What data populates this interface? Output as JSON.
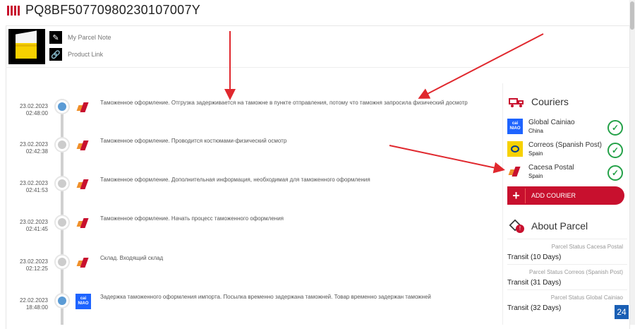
{
  "header": {
    "tracking_number": "PQ8BF50770980230107007Y"
  },
  "product": {
    "note_label": "My Parcel Note",
    "link_label": "Product Link"
  },
  "events": [
    {
      "date": "23.02.2023",
      "time": "02:48:00",
      "courier": "cacesa",
      "node": "blue",
      "text": "Таможенное оформление. Отгрузка задерживается на таможне в пункте отправления, потому что таможня запросила физический досмотр"
    },
    {
      "date": "23.02.2023",
      "time": "02:42:38",
      "courier": "cacesa",
      "node": "gray",
      "text": "Таможенное оформление. Проводится костюмами-физический осмотр"
    },
    {
      "date": "23.02.2023",
      "time": "02:41:53",
      "courier": "cacesa",
      "node": "gray",
      "text": "Таможенное оформление. Дополнительная информация, необходимая для таможенного оформления"
    },
    {
      "date": "23.02.2023",
      "time": "02:41:45",
      "courier": "cacesa",
      "node": "gray",
      "text": "Таможенное оформление. Начать процесс таможенного оформления"
    },
    {
      "date": "23.02.2023",
      "time": "02:12:25",
      "courier": "cacesa",
      "node": "gray",
      "text": "Склад. Входящий склад"
    },
    {
      "date": "22.02.2023",
      "time": "18:48:00",
      "courier": "cainiao",
      "node": "blue",
      "text": "Задержка таможенного оформления импорта. Посылка временно задержана таможней. Товар временно задержан таможней"
    }
  ],
  "couriers": {
    "title": "Couriers",
    "items": [
      {
        "name": "Global Cainiao",
        "country": "China",
        "logo": "cainiao"
      },
      {
        "name": "Correos (Spanish Post)",
        "country": "Spain",
        "logo": "correos"
      },
      {
        "name": "Cacesa Postal",
        "country": "Spain",
        "logo": "cacesa"
      }
    ],
    "add_label": "ADD COURIER"
  },
  "about": {
    "title": "About Parcel",
    "statuses": [
      {
        "label": "Parcel Status Cacesa Postal",
        "value": "Transit (10 Days)"
      },
      {
        "label": "Parcel Status Correos (Spanish Post)",
        "value": "Transit (31 Days)"
      },
      {
        "label": "Parcel Status Global Cainiao",
        "value": "Transit (32 Days)"
      }
    ]
  },
  "cainiao_logo_text": "cai NIAO",
  "badge": "24",
  "colors": {
    "brand": "#c8102e",
    "check": "#24a148",
    "cainiao": "#1e64ff",
    "correos": "#f7d100"
  }
}
